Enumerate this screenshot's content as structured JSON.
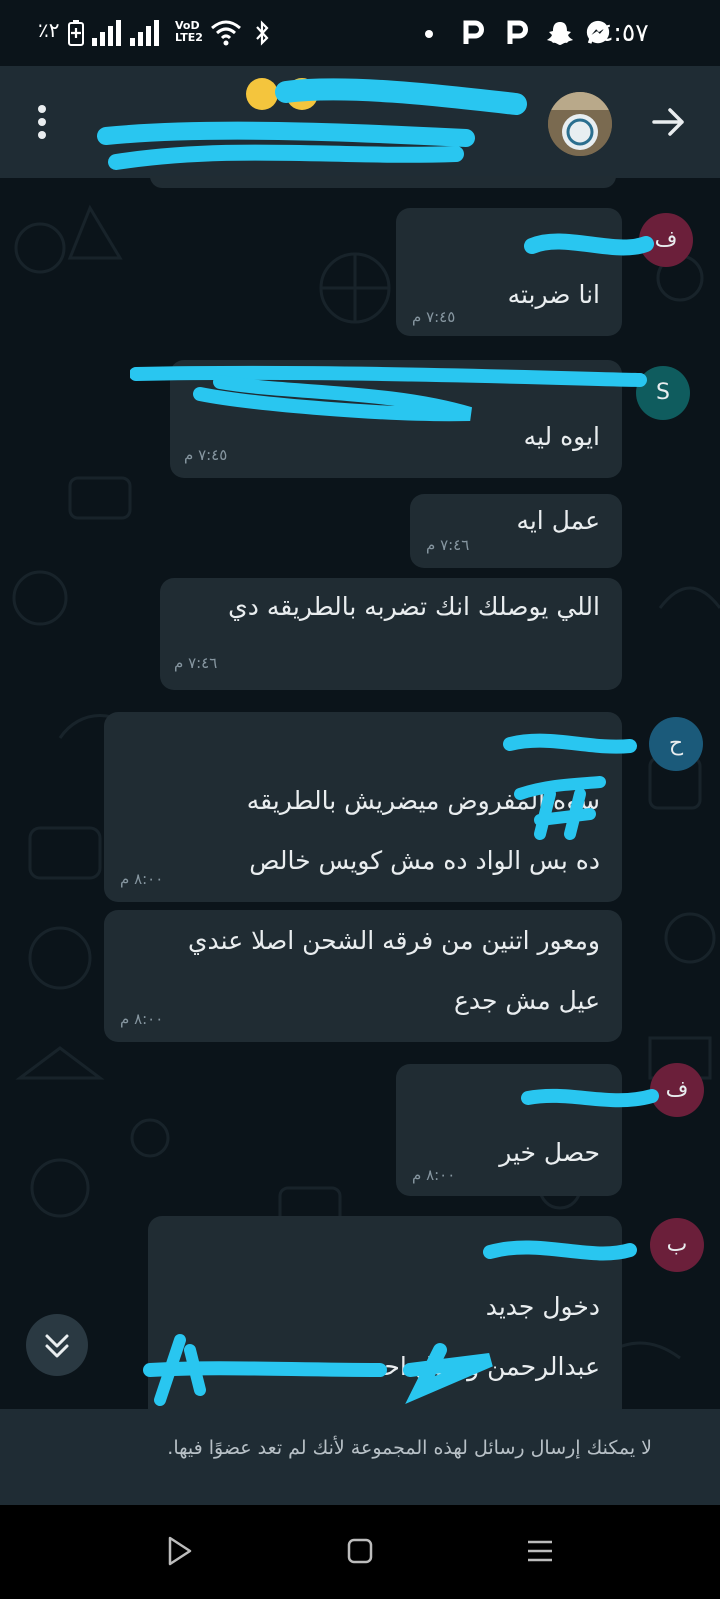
{
  "status_bar": {
    "time": "٤:٥٧",
    "battery": "٪٢",
    "network_label_top": "VoD",
    "network_label_bottom": "LTE2"
  },
  "messages": [
    {
      "text": "انا ضربته",
      "time": "٧:٤٥ م",
      "sender_initial": "ف"
    },
    {
      "text": "ايوه ليه",
      "time": "٧:٤٥ م",
      "sender_initial": "S"
    },
    {
      "text": "عمل ايه",
      "time": "٧:٤٦ م"
    },
    {
      "text": "اللي يوصلك انك تضربه بالطريقه دي",
      "time": "٧:٤٦ م"
    },
    {
      "line1": "سوه المفروض ميضريش بالطريقه",
      "line2": "ده بس الواد ده مش كويس خالص",
      "time": "٨:٠٠ م",
      "sender_initial": "ح"
    },
    {
      "line1": "ومعور اتنين من فرقه الشحن اصلا عندي",
      "line2": "عيل مش جدع",
      "time": "٨:٠٠ م"
    },
    {
      "text": "حصل خير",
      "time": "٨:٠٠ م",
      "sender_initial": "ف"
    },
    {
      "line1": "دخول جديد",
      "line2": "عبدالرحمن وصول احمد",
      "sender_initial": "ب"
    }
  ],
  "footer": {
    "notice": "لا يمكنك إرسال رسائل لهذه المجموعة لأنك لم تعد عضوًا فيها."
  },
  "colors": {
    "background": "#0b141a",
    "bubble": "#202c33",
    "appbar": "#1f2c34",
    "redaction": "#29c6f0",
    "avatar_f": "#6b1f3a",
    "avatar_s": "#0f5c5e",
    "avatar_h": "#1b5a7a",
    "avatar_b": "#6b1f3a"
  },
  "icons": [
    "back-arrow-icon",
    "more-options-icon",
    "scroll-down-icon",
    "nav-back-icon",
    "nav-home-icon",
    "nav-recents-icon",
    "whatsapp-messenger-icon",
    "snapchat-icon",
    "parking-icon",
    "wifi-icon",
    "bluetooth-icon",
    "signal-icon",
    "battery-icon"
  ]
}
